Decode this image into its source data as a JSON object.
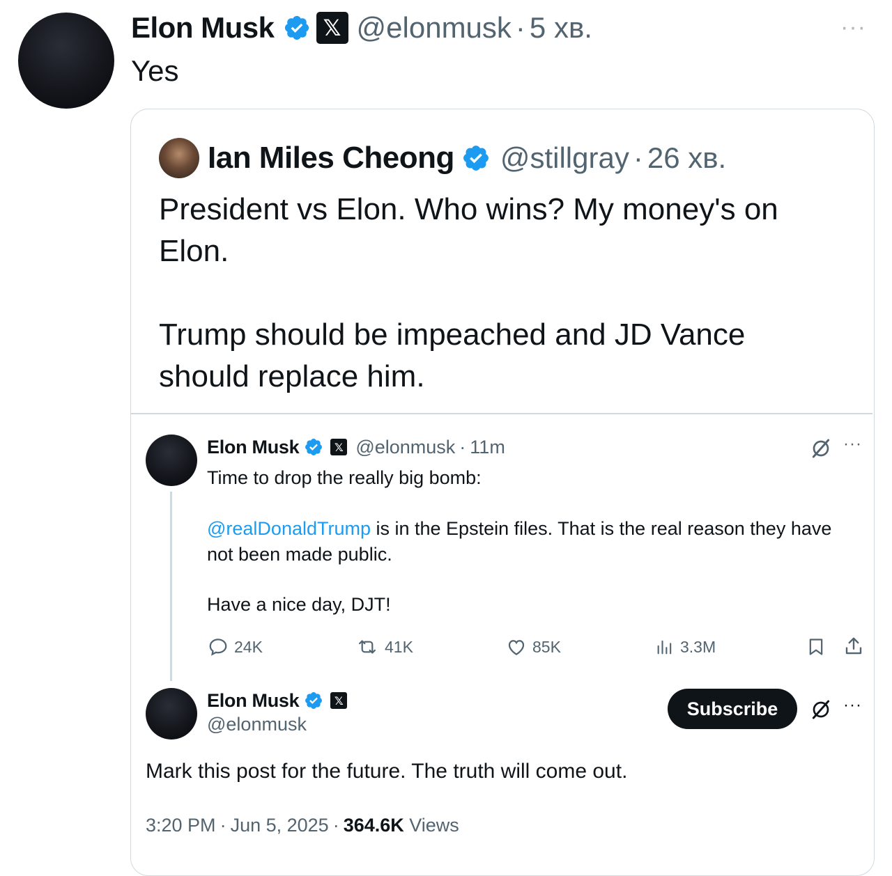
{
  "outer_tweet": {
    "name": "Elon Musk",
    "handle": "@elonmusk",
    "separator": "·",
    "time": "5 хв.",
    "text": "Yes"
  },
  "quoted_tweet": {
    "name": "Ian Miles Cheong",
    "handle": "@stillgray",
    "separator": "·",
    "time": "26 хв.",
    "text_line1": "President vs Elon. Who wins? My money's on",
    "text_line2": "Elon.",
    "text_line3": "Trump should be impeached and JD Vance",
    "text_line4": "should replace him."
  },
  "screenshot": {
    "post1": {
      "name": "Elon Musk",
      "handle": "@elonmusk",
      "separator": "·",
      "time": "11m",
      "line1": "Time to drop the really big bomb:",
      "mention": "@realDonaldTrump",
      "line2_rest": " is in the Epstein files. That is the real reason they have",
      "line3": "not been made public.",
      "line4": "Have a nice day, DJT!",
      "replies": "24K",
      "reposts": "41K",
      "likes": "85K",
      "views": "3.3M"
    },
    "post2": {
      "name": "Elon Musk",
      "handle": "@elonmusk",
      "subscribe_label": "Subscribe",
      "text": "Mark this post for the future. The truth will come out.",
      "time": "3:20 PM",
      "separator": "·",
      "date": "Jun 5, 2025",
      "separator2": "·",
      "views_count": "364.6K",
      "views_label": " Views"
    }
  },
  "icons": {
    "verified": "verified-badge-icon",
    "x_logo": "x-logo-icon",
    "more": "more-icon",
    "grok": "grok-icon"
  },
  "colors": {
    "verified_blue": "#1d9bf0",
    "text_primary": "#0f1419",
    "text_secondary": "#536471",
    "border": "#cfd9de"
  }
}
